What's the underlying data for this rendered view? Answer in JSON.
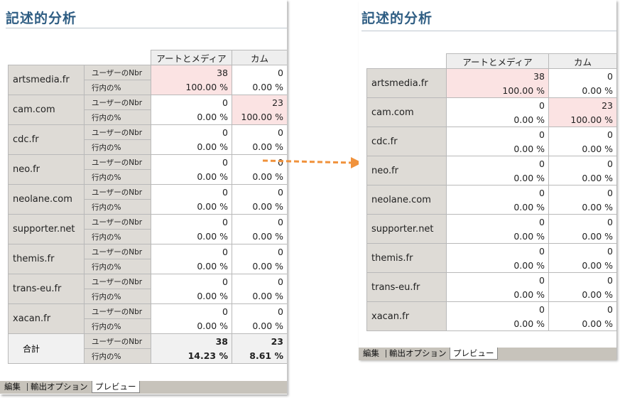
{
  "title": "記述的分析",
  "columns": [
    "アートとメディア",
    "カム"
  ],
  "measures": [
    "ユーザーのNbr",
    "行内の%"
  ],
  "rows": [
    {
      "domain": "artsmedia.fr",
      "n1": "38",
      "p1": "100.00 %",
      "n2": "0",
      "p2": "0.00 %",
      "hi": 1
    },
    {
      "domain": "cam.com",
      "n1": "0",
      "p1": "0.00 %",
      "n2": "23",
      "p2": "100.00 %",
      "hi": 2
    },
    {
      "domain": "cdc.fr",
      "n1": "0",
      "p1": "0.00 %",
      "n2": "0",
      "p2": "0.00 %",
      "hi": 0
    },
    {
      "domain": "neo.fr",
      "n1": "0",
      "p1": "0.00 %",
      "n2": "0",
      "p2": "0.00 %",
      "hi": 0
    },
    {
      "domain": "neolane.com",
      "n1": "0",
      "p1": "0.00 %",
      "n2": "0",
      "p2": "0.00 %",
      "hi": 0
    },
    {
      "domain": "supporter.net",
      "n1": "0",
      "p1": "0.00 %",
      "n2": "0",
      "p2": "0.00 %",
      "hi": 0
    },
    {
      "domain": "themis.fr",
      "n1": "0",
      "p1": "0.00 %",
      "n2": "0",
      "p2": "0.00 %",
      "hi": 0
    },
    {
      "domain": "trans-eu.fr",
      "n1": "0",
      "p1": "0.00 %",
      "n2": "0",
      "p2": "0.00 %",
      "hi": 0
    },
    {
      "domain": "xacan.fr",
      "n1": "0",
      "p1": "0.00 %",
      "n2": "0",
      "p2": "0.00 %",
      "hi": 0
    }
  ],
  "total": {
    "label": "合計",
    "n1": "38",
    "p1": "14.23 %",
    "n2": "23",
    "p2": "8.61 %"
  },
  "tabs": {
    "edit": "編集",
    "export": "輸出オプション",
    "preview": "プレビュー"
  },
  "colors": {
    "title": "#2e5d83",
    "highlight": "#fbe3e3",
    "arrow": "#f0923c"
  }
}
